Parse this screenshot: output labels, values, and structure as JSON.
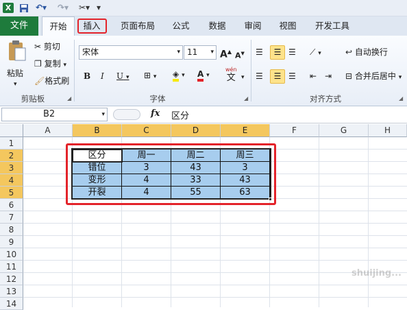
{
  "quick_access": {
    "excel_icon": "excel-logo-icon",
    "save_icon": "save-icon",
    "undo_icon": "undo-icon",
    "redo_icon": "redo-icon",
    "customize_icon": "customize-icon"
  },
  "tabs": {
    "file": "文件",
    "items": [
      "开始",
      "插入",
      "页面布局",
      "公式",
      "数据",
      "审阅",
      "视图",
      "开发工具"
    ],
    "active": "开始",
    "highlighted": "插入"
  },
  "ribbon": {
    "clipboard": {
      "paste": "粘贴",
      "cut": "剪切",
      "copy": "复制",
      "format_painter": "格式刷",
      "group_label": "剪贴板"
    },
    "font": {
      "font_name": "宋体",
      "font_size": "11",
      "bold": "B",
      "italic": "I",
      "underline": "U",
      "phonetic": "wén",
      "phonetic_char": "文",
      "grow": "A",
      "shrink": "A",
      "font_color_letter": "A",
      "group_label": "字体"
    },
    "alignment": {
      "wrap_text": "自动换行",
      "merge_center": "合并后居中",
      "group_label": "对齐方式"
    }
  },
  "formula_bar": {
    "name_box": "B2",
    "fx": "fx",
    "content": "区分"
  },
  "grid": {
    "columns": [
      "A",
      "B",
      "C",
      "D",
      "E",
      "F",
      "G",
      "H"
    ],
    "selected_columns": [
      "B",
      "C",
      "D",
      "E"
    ],
    "rows": [
      "1",
      "2",
      "3",
      "4",
      "5",
      "6",
      "7",
      "8",
      "9",
      "10",
      "11",
      "12",
      "13",
      "14"
    ],
    "selected_rows": [
      "2",
      "3",
      "4",
      "5"
    ]
  },
  "table": {
    "header": [
      "区分",
      "周一",
      "周二",
      "周三"
    ],
    "rows": [
      [
        "错位",
        "3",
        "43",
        "3"
      ],
      [
        "变形",
        "4",
        "33",
        "43"
      ],
      [
        "开裂",
        "4",
        "55",
        "63"
      ]
    ]
  },
  "watermark": "shuijing..."
}
